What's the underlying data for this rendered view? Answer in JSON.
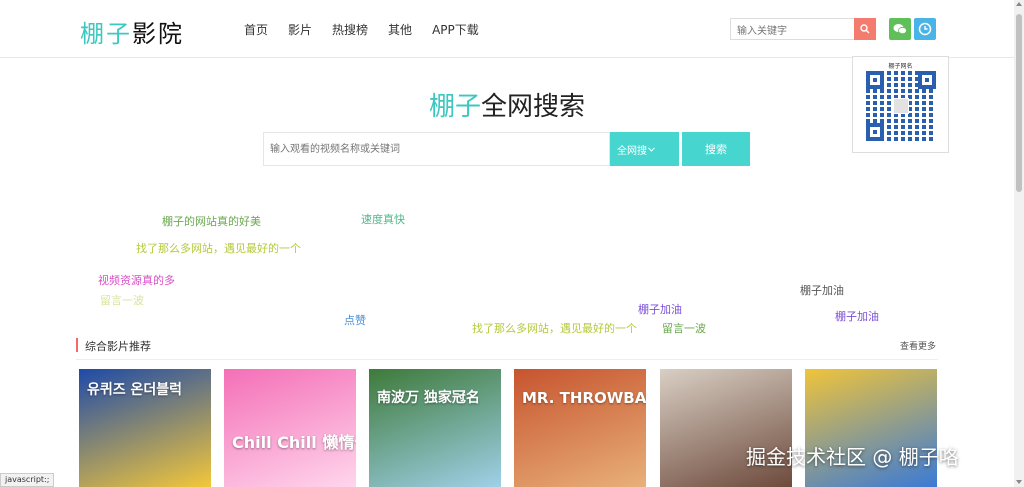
{
  "header": {
    "logo_part1": "棚子",
    "logo_part2": "影院",
    "nav": [
      "首页",
      "影片",
      "热搜榜",
      "其他",
      "APP下载"
    ],
    "search_placeholder": "输入关键字"
  },
  "qr_popup": {
    "caption": "棚子网名"
  },
  "hero": {
    "title_highlight": "棚子",
    "title_rest": "全网搜索",
    "search_placeholder": "输入观看的视频名称或关键词",
    "scope_label": "全网搜",
    "search_button": "搜索"
  },
  "danmaku": [
    {
      "text": "棚子的网站真的好美",
      "color": "#6aa84f"
    },
    {
      "text": "速度真快",
      "color": "#4fb88a"
    },
    {
      "text": "找了那么多网站，遇见最好的一个",
      "color": "#b5c93a"
    },
    {
      "text": "视频资源真的多",
      "color": "#d94fc7"
    },
    {
      "text": "留言一波",
      "color": "#d8e4a0"
    },
    {
      "text": "棚子加油",
      "color": "#555555"
    },
    {
      "text": "棚子加油",
      "color": "#7b4fd6"
    },
    {
      "text": "棚子加油",
      "color": "#7b4fd6"
    },
    {
      "text": "点赞",
      "color": "#4a8fd6"
    },
    {
      "text": "找了那么多网站，遇见最好的一个",
      "color": "#b5c93a"
    },
    {
      "text": "留言一波",
      "color": "#6aa84f"
    }
  ],
  "section": {
    "title": "综合影片推荐",
    "more": "查看更多"
  },
  "posters": [
    {
      "label": "유퀴즈 온더블럭",
      "colors": [
        "#1e4aa8",
        "#f3c73a"
      ]
    },
    {
      "label": "Chill Chill 懒惰长",
      "colors": [
        "#f46fb7",
        "#ffd6ec"
      ]
    },
    {
      "label": "南波万 独家冠名",
      "colors": [
        "#3e7a3a",
        "#9fd0e8"
      ]
    },
    {
      "label": "MR. THROWBACK",
      "colors": [
        "#c7542e",
        "#e8b07a"
      ]
    },
    {
      "label": "",
      "colors": [
        "#d9cfc4",
        "#6d4a3c"
      ]
    },
    {
      "label": "",
      "colors": [
        "#f0c43a",
        "#3a7ad6"
      ]
    }
  ],
  "overlay": {
    "watermark": "掘金技术社区 @ 棚子咯",
    "status": "javascript:;"
  }
}
